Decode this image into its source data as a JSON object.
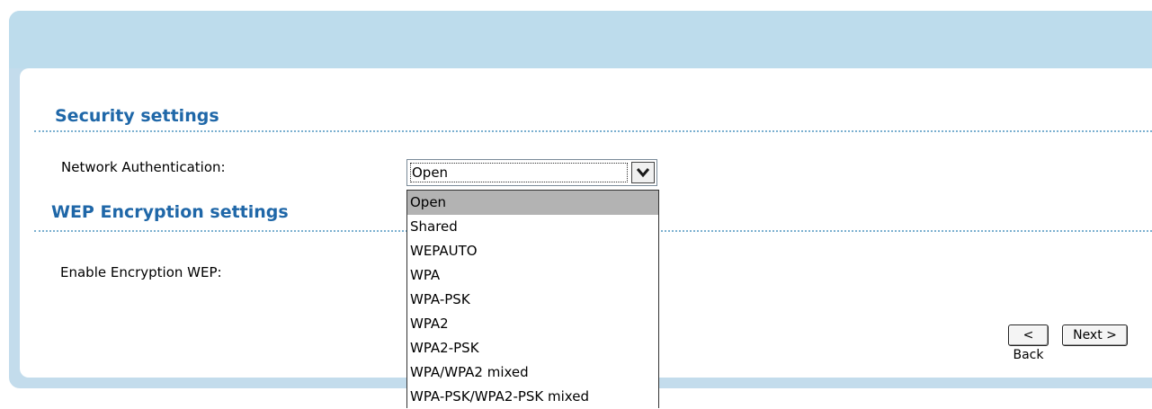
{
  "sections": {
    "security": {
      "title": "Security settings"
    },
    "wep": {
      "title": "WEP Encryption settings"
    }
  },
  "fields": {
    "network_auth_label": "Network Authentication:",
    "network_auth_value": "Open",
    "enable_wep_label": "Enable Encryption WEP:"
  },
  "dropdown": {
    "options": [
      "Open",
      "Shared",
      "WEPAUTO",
      "WPA",
      "WPA-PSK",
      "WPA2",
      "WPA2-PSK",
      "WPA/WPA2 mixed",
      "WPA-PSK/WPA2-PSK mixed"
    ],
    "selected": "Open"
  },
  "buttons": {
    "back": "< Back",
    "next": "Next >"
  },
  "colors": {
    "section_title": "#1f67a8",
    "panel_frame": "#c3dcec",
    "selected_option": "#b3b3b3"
  }
}
